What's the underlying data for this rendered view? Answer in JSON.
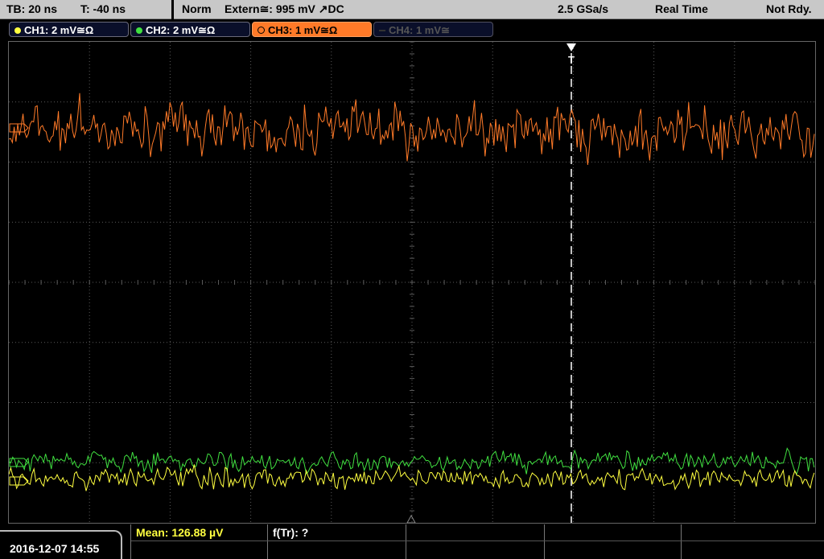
{
  "top": {
    "timebase": "TB: 20 ns",
    "trigger_pos": "T: -40 ns",
    "mode": "Norm",
    "trigger_source": "Extern≅: 995 mV ↗DC",
    "sample_rate": "2.5 GSa/s",
    "acq_mode": "Real Time",
    "status": "Not Rdy."
  },
  "channels": [
    {
      "label": "CH1: 2 mV≅Ω",
      "color": "#ffff40"
    },
    {
      "label": "CH2: 2 mV≅Ω",
      "color": "#40e040"
    },
    {
      "label": "CH3: 1 mV≅Ω",
      "color": "#ff7a28"
    },
    {
      "label": "CH4: 1 mV≅",
      "color": "#555555"
    }
  ],
  "markers": {
    "trigger": "T",
    "ch3": "3→",
    "ch2": "2→",
    "ch1": "1→"
  },
  "bottom": {
    "datetime": "2016-12-07 14:55",
    "mean": "Mean: 126.88 µV",
    "freq": "f(Tr): ?"
  },
  "colors": {
    "ch1": "#ffff40",
    "ch2": "#40e040",
    "ch3": "#ff7a28",
    "grid": "#5a5a5a",
    "mean_text": "#ffff40"
  }
}
